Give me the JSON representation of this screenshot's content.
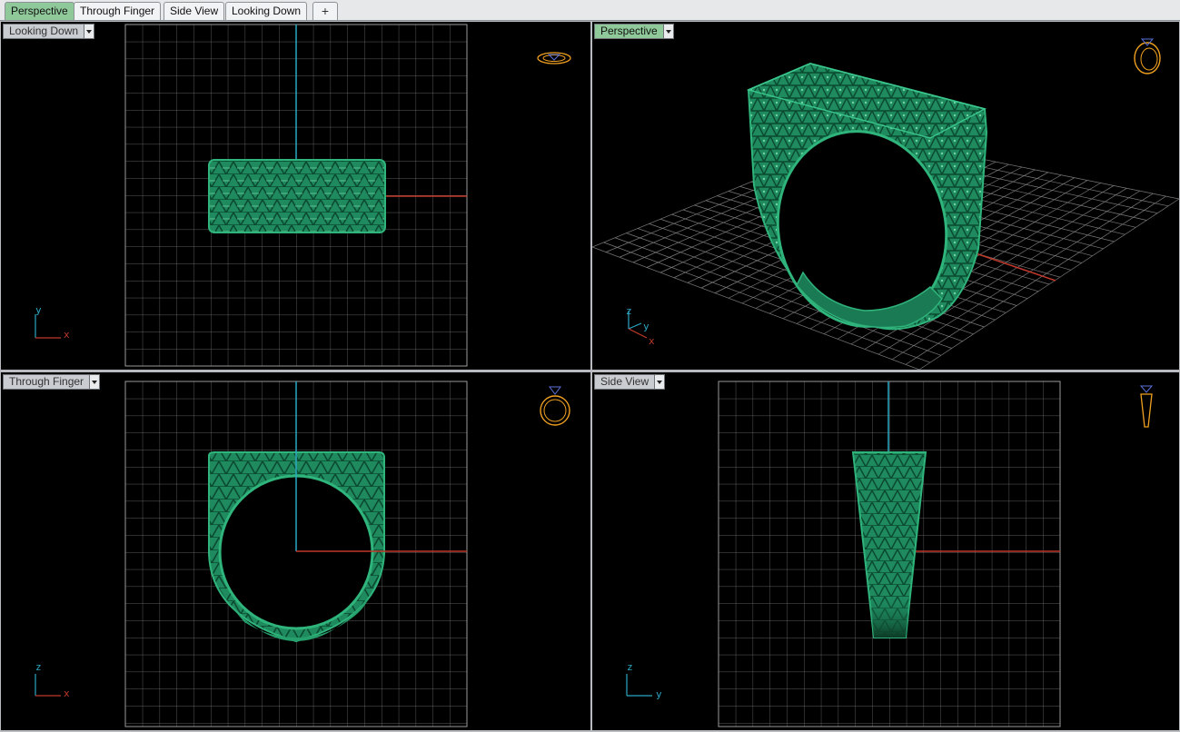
{
  "tabs": [
    {
      "label": "Perspective",
      "active": true
    },
    {
      "label": "Through Finger",
      "active": false
    },
    {
      "label": "Side View",
      "active": false
    },
    {
      "label": "Looking Down",
      "active": false
    }
  ],
  "add_tab_label": "+",
  "viewports": {
    "top_left": {
      "title": "Looking Down",
      "axes": [
        "y",
        "x"
      ]
    },
    "top_right": {
      "title": "Perspective",
      "axes": [
        "z",
        "y",
        "x"
      ]
    },
    "bottom_left": {
      "title": "Through Finger",
      "axes": [
        "z",
        "x"
      ]
    },
    "bottom_right": {
      "title": "Side View",
      "axes": [
        "z",
        "y"
      ]
    }
  },
  "colors": {
    "model_green": "#1e8a5e",
    "grid": "#8c8c8c",
    "axis_x": "#c0392b",
    "axis_y": "#2ba8c4",
    "nav_gizmo": "#f0a020",
    "active_tab": "#8fc99a"
  },
  "icons": [
    "dropdown-arrow-icon",
    "ring-navigation-gizmo-icon",
    "plus-icon"
  ]
}
